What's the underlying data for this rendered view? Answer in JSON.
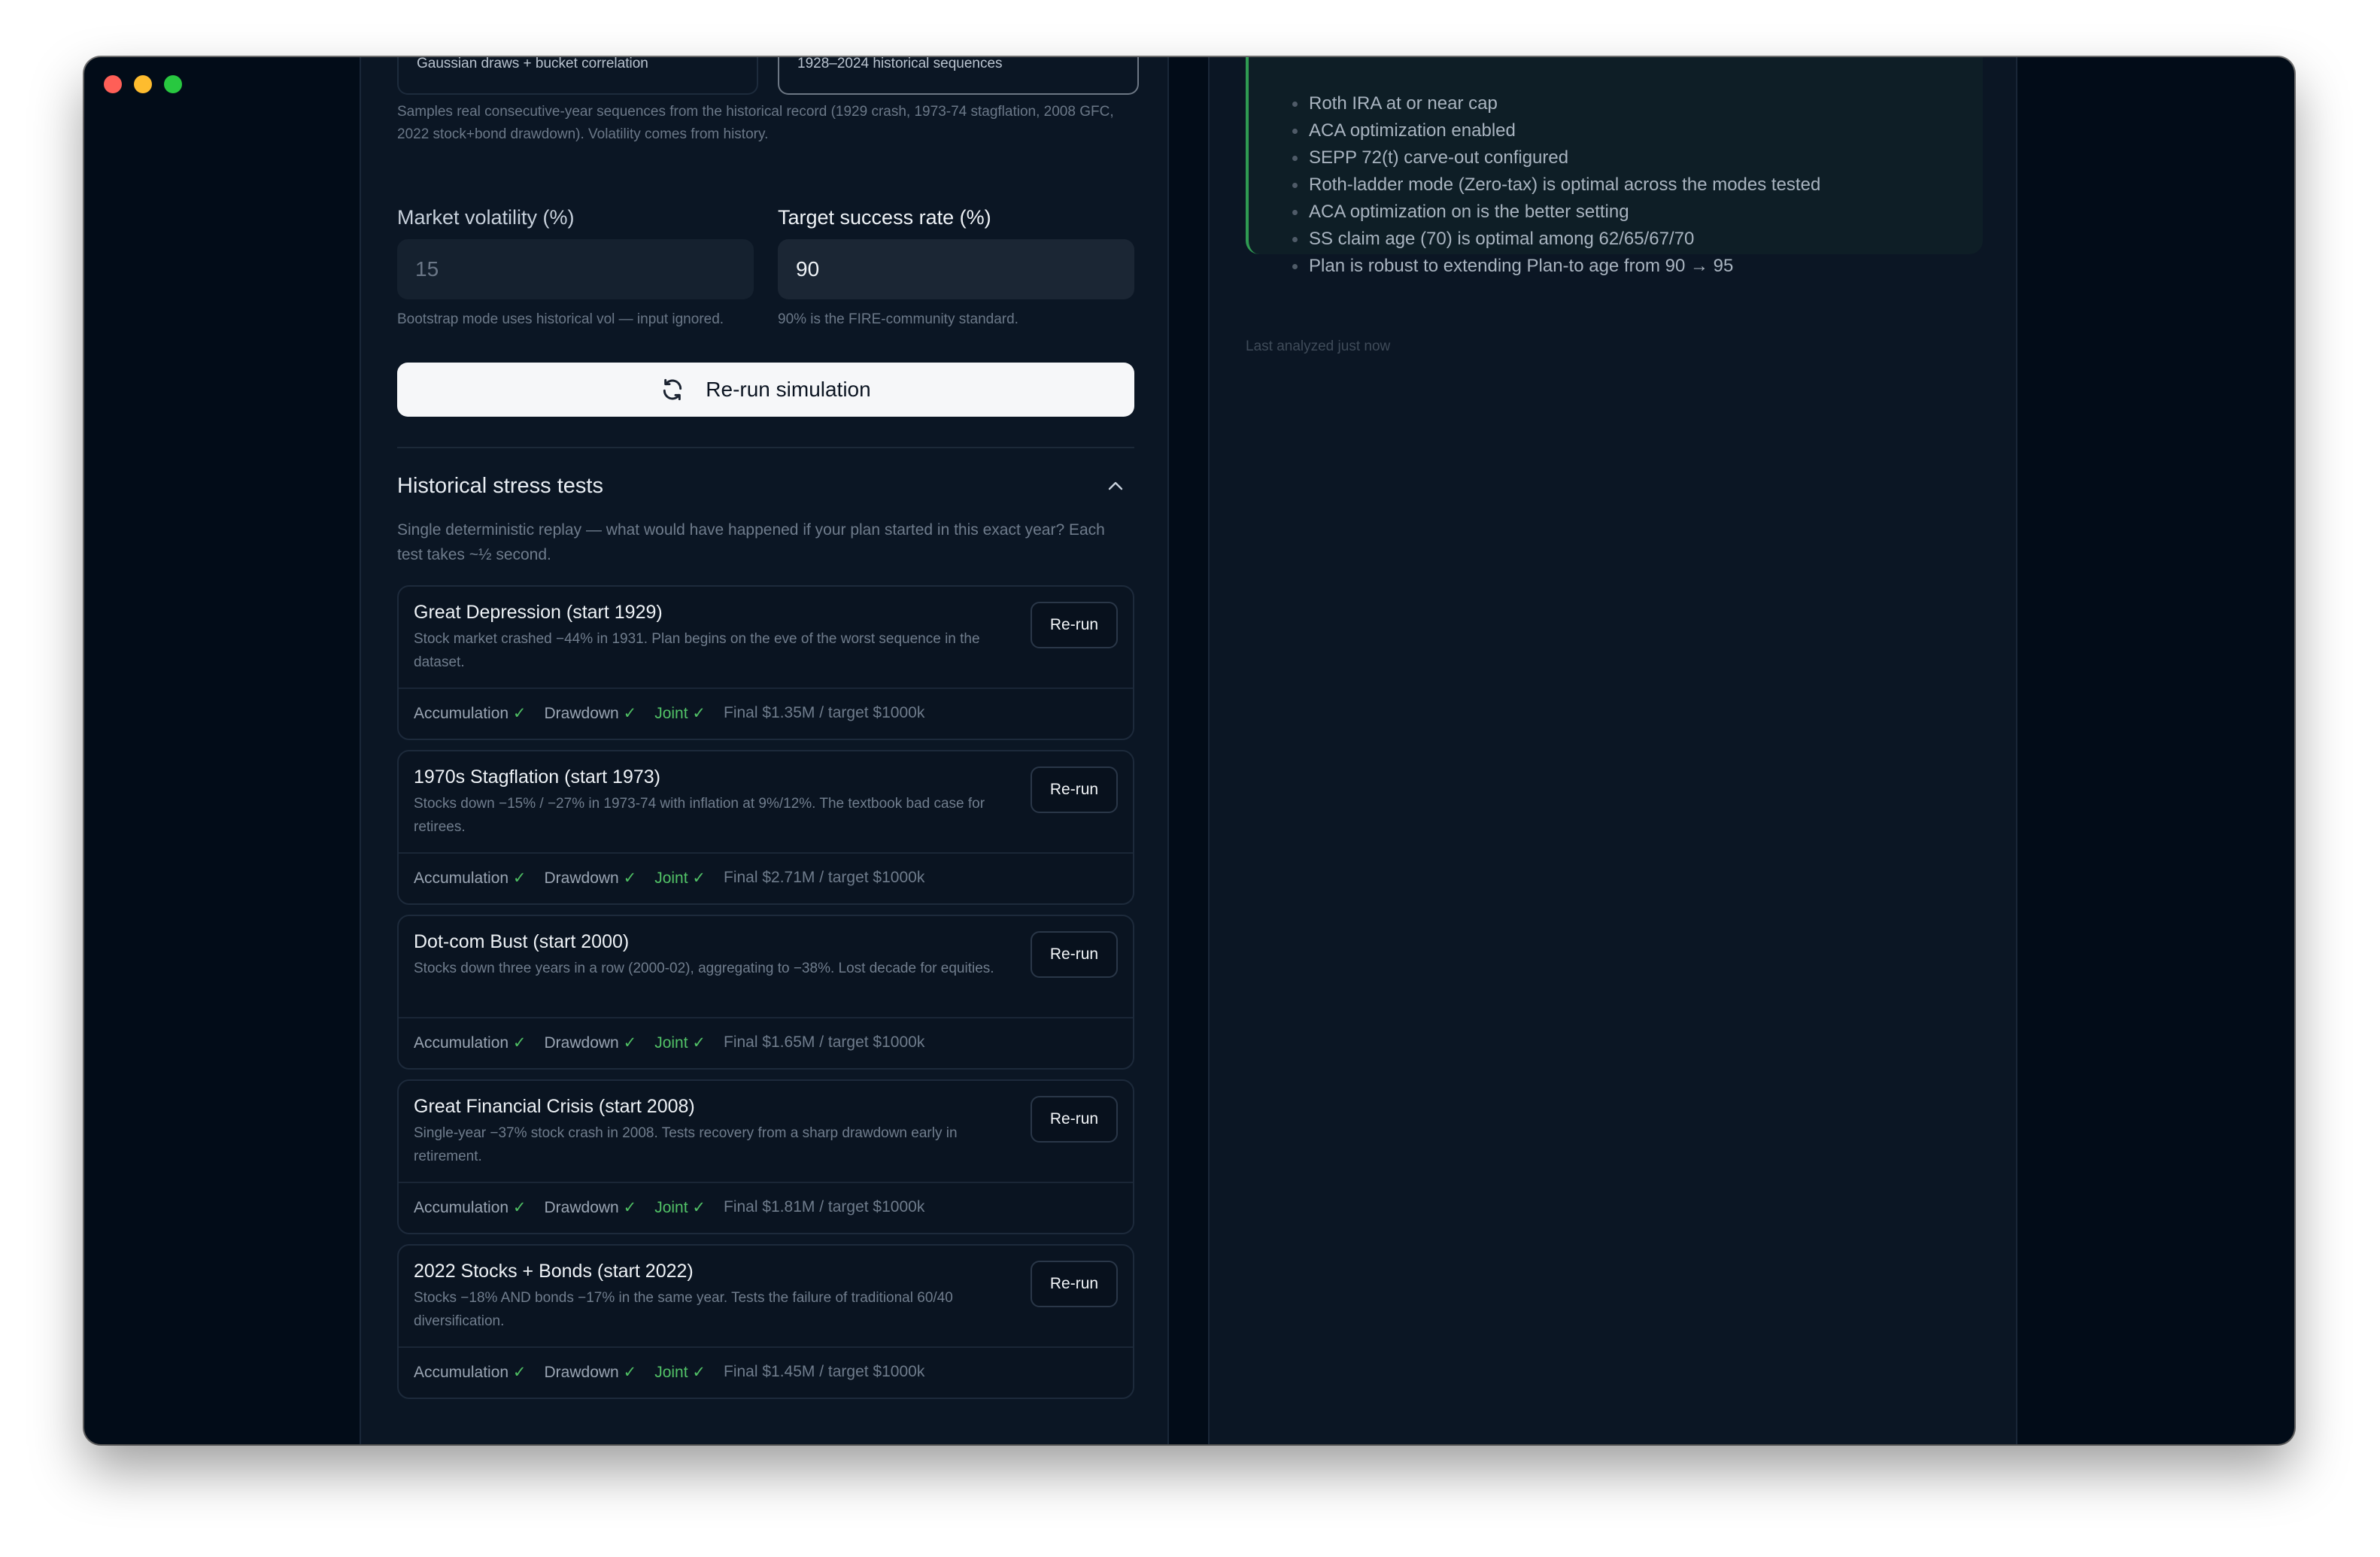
{
  "sim_settings": {
    "mode_gaussian": "Gaussian draws + bucket correlation",
    "mode_bootstrap": "1928–2024 historical sequences",
    "mode_description": "Samples real consecutive-year sequences from the historical record (1929 crash, 1973-74 stagflation, 2008 GFC, 2022 stock+bond drawdown). Volatility comes from history.",
    "volatility_label": "Market volatility (%)",
    "volatility_value": "15",
    "volatility_hint": "Bootstrap mode uses historical vol — input ignored.",
    "target_label": "Target success rate (%)",
    "target_value": "90",
    "target_hint": "90% is the FIRE-community standard.",
    "rerun_label": "Re-run simulation"
  },
  "stress_tests": {
    "title": "Historical stress tests",
    "description": "Single deterministic replay — what would have happened if your plan started in this exact year? Each test takes ~½ second.",
    "button_label": "Re-run",
    "labels": {
      "accumulation": "Accumulation",
      "drawdown": "Drawdown",
      "joint": "Joint",
      "check": "✓"
    },
    "tests": [
      {
        "title": "Great Depression (start 1929)",
        "description": "Stock market crashed −44% in 1931. Plan begins on the eve of the worst sequence in the dataset.",
        "final": "Final $1.35M / target $1000k"
      },
      {
        "title": "1970s Stagflation (start 1973)",
        "description": "Stocks down −15% / −27% in 1973-74 with inflation at 9%/12%. The textbook bad case for retirees.",
        "final": "Final $2.71M / target $1000k"
      },
      {
        "title": "Dot-com Bust (start 2000)",
        "description": "Stocks down three years in a row (2000-02), aggregating to −38%. Lost decade for equities.",
        "final": "Final $1.65M / target $1000k"
      },
      {
        "title": "Great Financial Crisis (start 2008)",
        "description": "Single-year −37% stock crash in 2008. Tests recovery from a sharp drawdown early in retirement.",
        "final": "Final $1.81M / target $1000k"
      },
      {
        "title": "2022 Stocks + Bonds (start 2022)",
        "description": "Stocks −18% AND bonds −17% in the same year. Tests the failure of traditional 60/40 diversification.",
        "final": "Final $1.45M / target $1000k"
      }
    ]
  },
  "insights": {
    "items": [
      "Roth IRA at or near cap",
      "ACA optimization enabled",
      "SEPP 72(t) carve-out configured",
      "Roth-ladder mode (Zero-tax) is optimal across the modes tested",
      "ACA optimization on is the better setting",
      "SS claim age (70) is optimal among 62/65/67/70",
      "Plan is robust to extending Plan-to age from 90 → 95"
    ],
    "last_analyzed": "Last analyzed just now"
  }
}
